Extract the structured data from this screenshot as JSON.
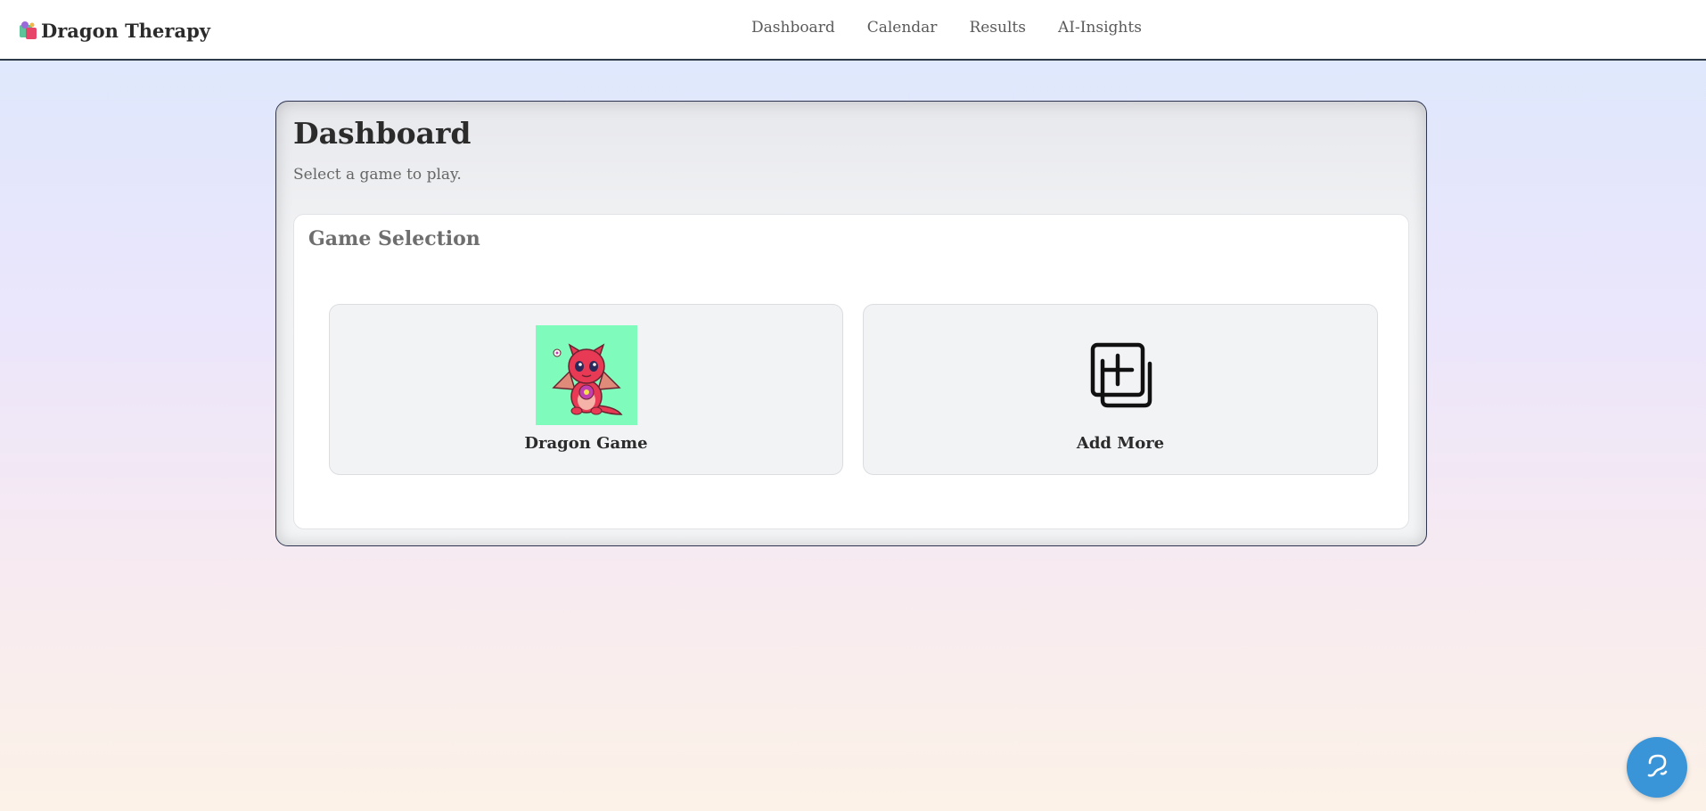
{
  "app": {
    "name": "Dragon Therapy",
    "logo_icon": "dragon-logo-icon"
  },
  "nav": {
    "items": [
      {
        "label": "Dashboard"
      },
      {
        "label": "Calendar"
      },
      {
        "label": "Results"
      },
      {
        "label": "AI-Insights"
      }
    ]
  },
  "main": {
    "title": "Dashboard",
    "subtitle": "Select a game to play.",
    "section_title": "Game Selection",
    "games": [
      {
        "label": "Dragon Game",
        "icon": "dragon-game-image",
        "bg_color": "#7ffbbb"
      },
      {
        "label": "Add More",
        "icon": "add-more-icon"
      }
    ]
  },
  "fab": {
    "icon": "assistant-chat-icon",
    "color": "#3a95d8"
  }
}
